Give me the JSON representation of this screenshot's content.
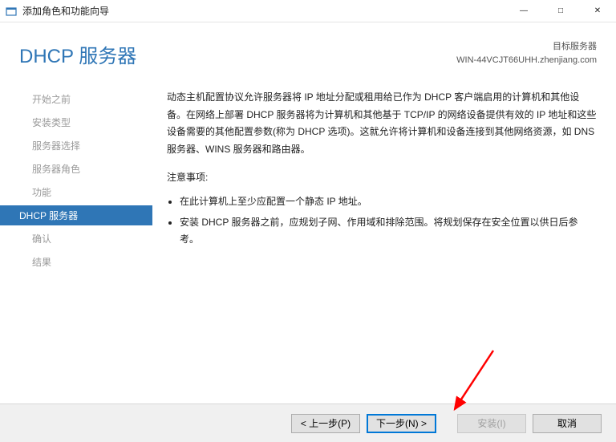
{
  "titlebar": {
    "title": "添加角色和功能向导"
  },
  "header": {
    "title": "DHCP 服务器",
    "target_label": "目标服务器",
    "target_value": "WIN-44VCJT66UHH.zhenjiang.com"
  },
  "sidebar": {
    "items": [
      {
        "label": "开始之前"
      },
      {
        "label": "安装类型"
      },
      {
        "label": "服务器选择"
      },
      {
        "label": "服务器角色"
      },
      {
        "label": "功能"
      },
      {
        "label": "DHCP 服务器"
      },
      {
        "label": "确认"
      },
      {
        "label": "结果"
      }
    ]
  },
  "content": {
    "paragraph": "动态主机配置协议允许服务器将 IP 地址分配或租用给已作为 DHCP 客户端启用的计算机和其他设备。在网络上部署 DHCP 服务器将为计算机和其他基于 TCP/IP 的网络设备提供有效的 IP 地址和这些设备需要的其他配置参数(称为 DHCP 选项)。这就允许将计算机和设备连接到其他网络资源，如 DNS 服务器、WINS 服务器和路由器。",
    "notes_title": "注意事项:",
    "notes": [
      "在此计算机上至少应配置一个静态 IP 地址。",
      "安装 DHCP 服务器之前，应规划子网、作用域和排除范围。将规划保存在安全位置以供日后参考。"
    ]
  },
  "footer": {
    "previous": "< 上一步(P)",
    "next": "下一步(N) >",
    "install": "安装(I)",
    "cancel": "取消"
  }
}
